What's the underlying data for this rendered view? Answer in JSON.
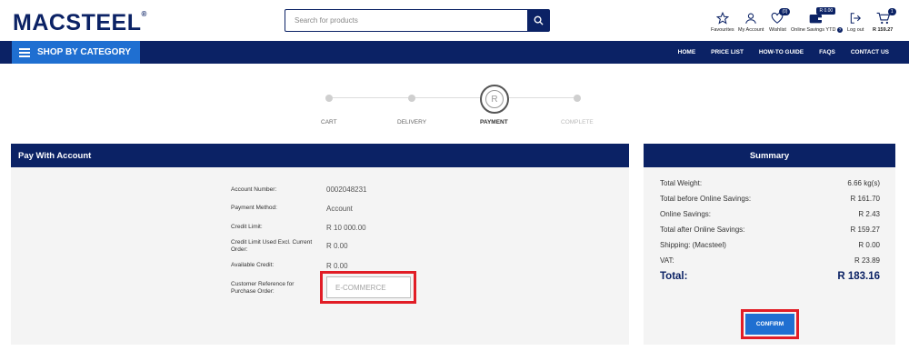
{
  "header": {
    "logo_text": "MACSTEEL",
    "logo_mark": "®",
    "search_placeholder": "Search for products",
    "tools": {
      "favourites": "Favourites",
      "my_account": "My Account",
      "wishlist": "Wishlist",
      "wishlist_count": "(0)",
      "online_savings": "Online Savings YTD",
      "online_savings_amount": "R 0.00",
      "logout": "Log out",
      "cart_total": "R 159.27",
      "cart_count": "1"
    }
  },
  "nav": {
    "shop_by_category": "SHOP BY CATEGORY",
    "links": [
      "HOME",
      "PRICE LIST",
      "HOW-TO GUIDE",
      "FAQS",
      "CONTACT US"
    ]
  },
  "steps": {
    "active_icon": "R",
    "labels": [
      "CART",
      "DELIVERY",
      "PAYMENT",
      "COMPLETE"
    ],
    "active_index": 2
  },
  "pay": {
    "title": "Pay With Account",
    "rows": [
      {
        "label": "Account Number:",
        "value": "0002048231"
      },
      {
        "label": "Payment Method:",
        "value": "Account"
      },
      {
        "label": "Credit Limit:",
        "value": "R 10 000.00"
      },
      {
        "label": "Credit Limit Used Excl. Current Order:",
        "value": "R 0.00"
      },
      {
        "label": "Available Credit:",
        "value": "R 0.00"
      }
    ],
    "reference_label": "Customer Reference for Purchase Order:",
    "reference_placeholder": "E-COMMERCE"
  },
  "summary": {
    "title": "Summary",
    "rows": [
      {
        "label": "Total Weight:",
        "value": "6.66 kg(s)"
      },
      {
        "label": "Total before Online Savings:",
        "value": "R 161.70"
      },
      {
        "label": "Online Savings:",
        "value": "R 2.43"
      },
      {
        "label": "Total after Online Savings:",
        "value": "R 159.27"
      },
      {
        "label": "Shipping: (Macsteel)",
        "value": "R 0.00"
      },
      {
        "label": "VAT:",
        "value": "R 23.89"
      }
    ],
    "total_label": "Total:",
    "total_value": "R 183.16",
    "confirm_label": "CONFIRM"
  },
  "colors": {
    "brand_navy": "#0b2265",
    "accent_blue": "#1f6fd1",
    "highlight_red": "#e11d26"
  }
}
